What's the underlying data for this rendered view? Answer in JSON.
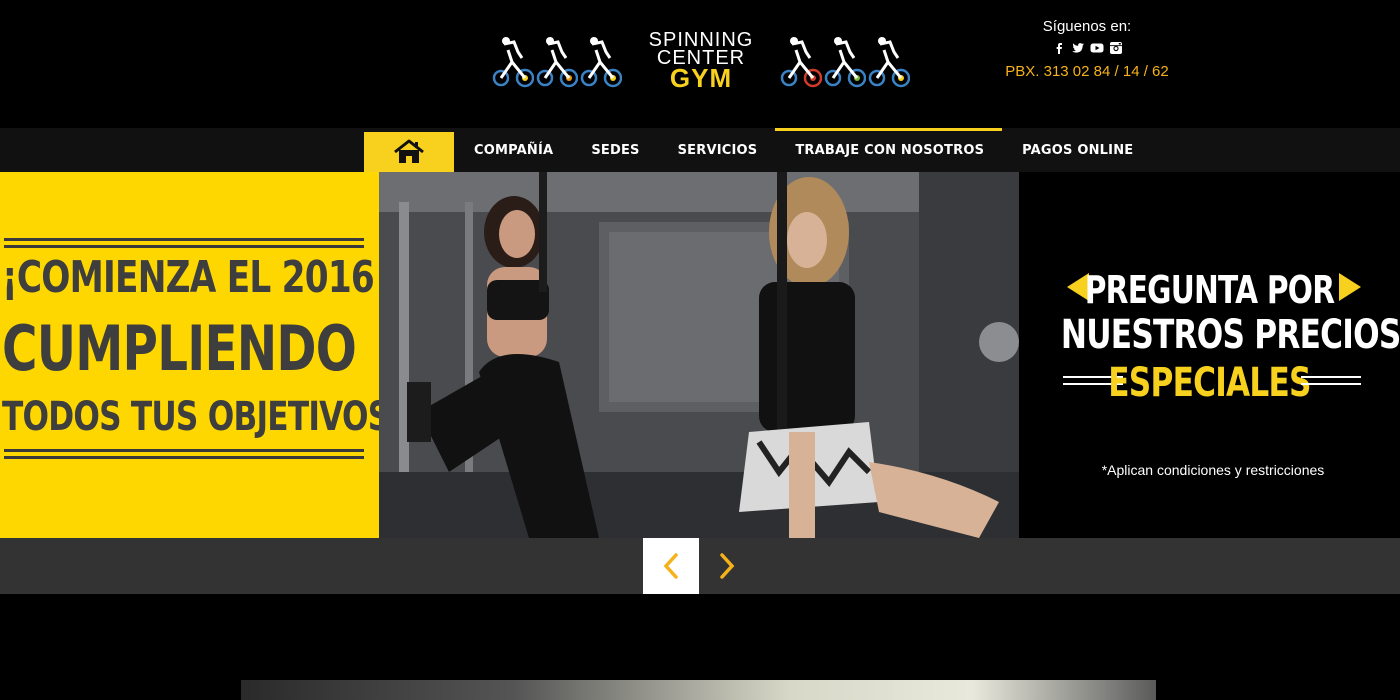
{
  "header": {
    "logo": {
      "line1": "SPINNING",
      "line2": "CENTER",
      "line3": "GYM",
      "icon": "spinning-bike-icon"
    },
    "social": {
      "follow_label": "Síguenos en:",
      "icons": [
        "facebook-icon",
        "twitter-icon",
        "youtube-icon",
        "instagram-icon"
      ],
      "phone": "PBX. 313 02 84 / 14 / 62"
    }
  },
  "nav": {
    "home_icon": "home-icon",
    "items": [
      {
        "label": "COMPAÑÍA"
      },
      {
        "label": "SEDES"
      },
      {
        "label": "SERVICIOS"
      },
      {
        "label": "TRABAJE CON NOSOTROS",
        "active": true
      },
      {
        "label": "PAGOS ONLINE"
      }
    ]
  },
  "slider": {
    "left": {
      "line1": "¡COMIENZA EL 2016",
      "line2": "CUMPLIENDO",
      "line3": "TODOS TUS OBJETIVOS!"
    },
    "right": {
      "line1": "PREGUNTA POR",
      "line2": "NUESTROS PRECIOS",
      "line3": "ESPECIALES",
      "note": "*Aplican condiciones y restricciones"
    },
    "controls": {
      "prev_icon": "chevron-left-icon",
      "next_icon": "chevron-right-icon"
    }
  },
  "colors": {
    "accent": "#f7d11e",
    "phone": "#f6b21a",
    "dark_text": "#3e3e3e",
    "control_bar": "#333333"
  }
}
